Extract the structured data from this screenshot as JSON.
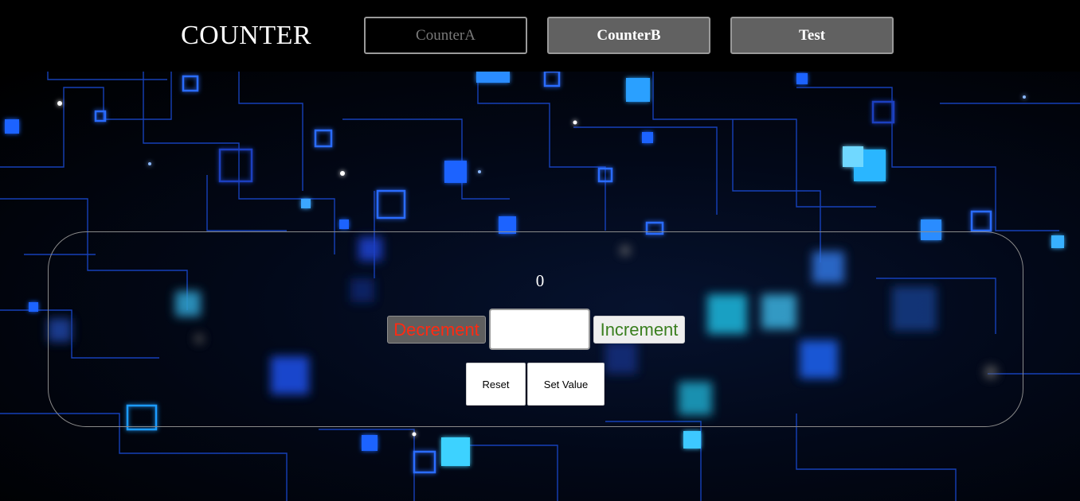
{
  "header": {
    "brand": "COUNTER",
    "nav": [
      {
        "label": "CounterA"
      },
      {
        "label": "CounterB"
      },
      {
        "label": "Test"
      }
    ]
  },
  "counter": {
    "value": "0",
    "input_value": "",
    "decrement_label": "Decrement",
    "increment_label": "Increment",
    "reset_label": "Reset",
    "set_value_label": "Set Value"
  },
  "colors": {
    "decrement_text": "#ff2a12",
    "increment_text": "#3a7f1f",
    "accent_blue": "#1f6bff"
  },
  "background": {
    "theme": "blue-circuit-network"
  }
}
